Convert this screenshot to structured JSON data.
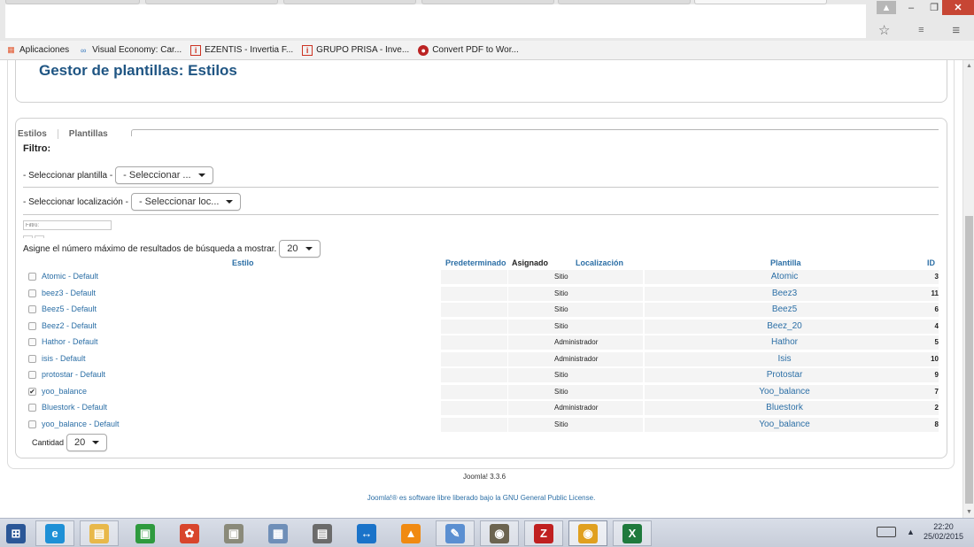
{
  "bookmarks": [
    {
      "label": "Aplicaciones",
      "icon": "apps-grid-icon"
    },
    {
      "label": "Visual Economy: Car...",
      "icon": "visual-economy-icon"
    },
    {
      "label": "EZENTIS - Invertia F...",
      "icon": "invertia-icon"
    },
    {
      "label": "GRUPO PRISA - Inve...",
      "icon": "invertia-icon"
    },
    {
      "label": "Convert PDF to Wor...",
      "icon": "pdf-converter-icon"
    }
  ],
  "page": {
    "title": "Gestor de plantillas: Estilos"
  },
  "tabs": [
    "Estilos",
    "Plantillas"
  ],
  "filters": {
    "label": "Filtro:",
    "template_label": "- Seleccionar plantilla -",
    "template_value": "- Seleccionar ...",
    "location_label": "- Seleccionar localización -",
    "location_value": "- Seleccionar loc...",
    "search_placeholder": "Filtro:",
    "limit_label": "Asigne el número máximo de resultados de búsqueda a mostrar.",
    "limit_value": "20"
  },
  "table": {
    "headers": {
      "estilo": "Estilo",
      "predeterminado": "Predeterminado",
      "asignado": "Asignado",
      "localizacion": "Localización",
      "plantilla": "Plantilla",
      "id": "ID"
    },
    "rows": [
      {
        "estilo": "Atomic - Default",
        "localizacion": "Sitio",
        "plantilla": "Atomic",
        "id": "3",
        "checked": false
      },
      {
        "estilo": "beez3 - Default",
        "localizacion": "Sitio",
        "plantilla": "Beez3",
        "id": "11",
        "checked": false
      },
      {
        "estilo": "Beez5 - Default",
        "localizacion": "Sitio",
        "plantilla": "Beez5",
        "id": "6",
        "checked": false
      },
      {
        "estilo": "Beez2 - Default",
        "localizacion": "Sitio",
        "plantilla": "Beez_20",
        "id": "4",
        "checked": false
      },
      {
        "estilo": "Hathor - Default",
        "localizacion": "Administrador",
        "plantilla": "Hathor",
        "id": "5",
        "checked": false
      },
      {
        "estilo": "isis - Default",
        "localizacion": "Administrador",
        "plantilla": "Isis",
        "id": "10",
        "checked": false
      },
      {
        "estilo": "protostar - Default",
        "localizacion": "Sitio",
        "plantilla": "Protostar",
        "id": "9",
        "checked": false
      },
      {
        "estilo": "yoo_balance",
        "localizacion": "Sitio",
        "plantilla": "Yoo_balance",
        "id": "7",
        "checked": true
      },
      {
        "estilo": "Bluestork - Default",
        "localizacion": "Administrador",
        "plantilla": "Bluestork",
        "id": "2",
        "checked": false
      },
      {
        "estilo": "yoo_balance - Default",
        "localizacion": "Sitio",
        "plantilla": "Yoo_balance",
        "id": "8",
        "checked": false
      }
    ]
  },
  "pagination": {
    "label": "Cantidad",
    "value": "20"
  },
  "footer": {
    "version": "Joomla! 3.3.6",
    "license_prefix": "Joomla!® es software libre liberado bajo la",
    "license_link": "GNU General Public License",
    "license_suffix": "."
  },
  "taskbar": {
    "apps": [
      "start-icon",
      "ie-icon",
      "file-explorer-icon",
      "store-icon",
      "picasa-icon",
      "scanner-icon",
      "calculator-icon",
      "movie-maker-icon",
      "teamviewer-icon",
      "vlc-icon",
      "paint-icon",
      "gimp-icon",
      "filezilla-icon",
      "chrome-icon",
      "excel-icon"
    ],
    "time": "22:20",
    "date": "25/02/2015"
  },
  "colors": {
    "link": "#2c6fa6",
    "title": "#1f5583",
    "close_button": "#c74634"
  }
}
